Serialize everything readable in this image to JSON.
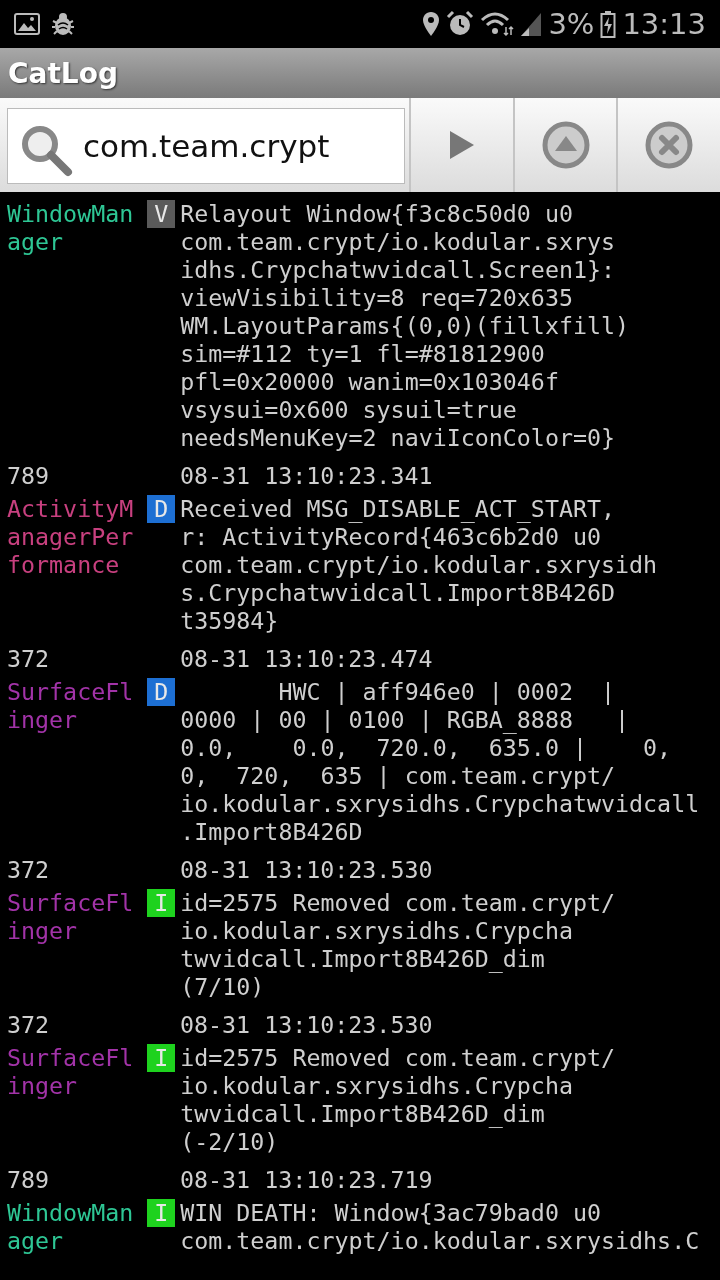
{
  "status_bar": {
    "battery": "3%",
    "time": "13:13"
  },
  "app_bar": {
    "title": "CatLog"
  },
  "search": {
    "value": "com.team.crypt"
  },
  "log": [
    {
      "tag": {
        "text": "WindowManager",
        "color": "#2ec795"
      },
      "priority": {
        "letter": "V",
        "color": "#5a5a5a"
      },
      "lines": [
        "Relayout Window{f3c8c50d0 u0",
        "com.team.crypt/io.kodular.sxrys",
        "idhs.Crypchatwvidcall.Screen1}:",
        "viewVisibility=8 req=720x635",
        "WM.LayoutParams{(0,0)(fillxfill)",
        "sim=#112 ty=1 fl=#81812900",
        "pfl=0x20000 wanim=0x103046f",
        "vsysui=0x600 sysuil=true",
        "needsMenuKey=2 naviIconColor=0}"
      ]
    },
    {
      "pid": "789",
      "time": "08-31 13:10:23.341",
      "tag": {
        "text": "ActivityManagerPerformance",
        "color": "#c8407f"
      },
      "priority": {
        "letter": "D",
        "color": "#1d6fd3"
      },
      "lines": [
        "Received MSG_DISABLE_ACT_START,",
        "r: ActivityRecord{463c6b2d0 u0",
        "com.team.crypt/io.kodular.sxrysidh",
        "s.Crypchatwvidcall.Import8B426D",
        "t35984}"
      ]
    },
    {
      "pid": "372",
      "time": "08-31 13:10:23.474",
      "tag": {
        "text": "SurfaceFlinger",
        "color": "#a233a8"
      },
      "priority": {
        "letter": "D",
        "color": "#1d6fd3"
      },
      "lines": [
        "       HWC | aff946e0 | 0002  |",
        "0000 | 00 | 0100 | RGBA_8888   |",
        "0.0,    0.0,  720.0,  635.0 |    0,",
        "0,  720,  635 | com.team.crypt/",
        "io.kodular.sxrysidhs.Crypchatwvidcall",
        ".Import8B426D"
      ]
    },
    {
      "pid": "372",
      "time": "08-31 13:10:23.530",
      "tag": {
        "text": "SurfaceFlinger",
        "color": "#a233a8"
      },
      "priority": {
        "letter": "I",
        "color": "#1ed21e"
      },
      "lines": [
        "id=2575 Removed com.team.crypt/",
        "io.kodular.sxrysidhs.Crypcha",
        "twvidcall.Import8B426D_dim",
        "(7/10)"
      ]
    },
    {
      "pid": "372",
      "time": "08-31 13:10:23.530",
      "tag": {
        "text": "SurfaceFlinger",
        "color": "#a233a8"
      },
      "priority": {
        "letter": "I",
        "color": "#1ed21e"
      },
      "lines": [
        "id=2575 Removed com.team.crypt/",
        "io.kodular.sxrysidhs.Crypcha",
        "twvidcall.Import8B426D_dim",
        "(-2/10)"
      ]
    },
    {
      "pid": "789",
      "time": "08-31 13:10:23.719",
      "tag": {
        "text": "WindowManager",
        "color": "#2ec795"
      },
      "priority": {
        "letter": "I",
        "color": "#1ed21e"
      },
      "lines": [
        "WIN DEATH: Window{3ac79bad0 u0",
        "com.team.crypt/io.kodular.sxrysidhs.C"
      ]
    }
  ]
}
